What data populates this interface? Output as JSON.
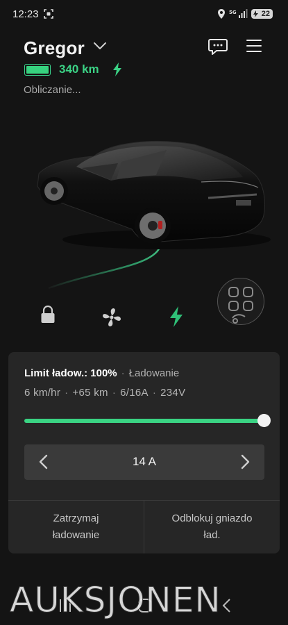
{
  "status_bar": {
    "time": "12:23",
    "battery_level": "22"
  },
  "header": {
    "car_name": "Gregor",
    "range": "340 km",
    "status": "Obliczanie..."
  },
  "charging_panel": {
    "limit_label": "Limit ładow.: 100%",
    "state": "Ładowanie",
    "rate": "6 km/hr",
    "added_range": "+65 km",
    "current_ratio": "6/16A",
    "voltage": "234V",
    "charge_limit_percent": 100,
    "amps_value": "14 A",
    "stop_button": [
      "Zatrzymaj",
      "ładowanie"
    ],
    "unlock_button": [
      "Odblokuj gniazdo",
      "ład."
    ]
  },
  "watermark": "AUKSJONEN",
  "colors": {
    "accent": "#3bd285",
    "background": "#141414",
    "panel": "#262626"
  },
  "icons": {
    "quick_controls": [
      "lock-icon",
      "fan-icon",
      "charge-bolt-icon",
      "apps-grid-icon"
    ]
  }
}
